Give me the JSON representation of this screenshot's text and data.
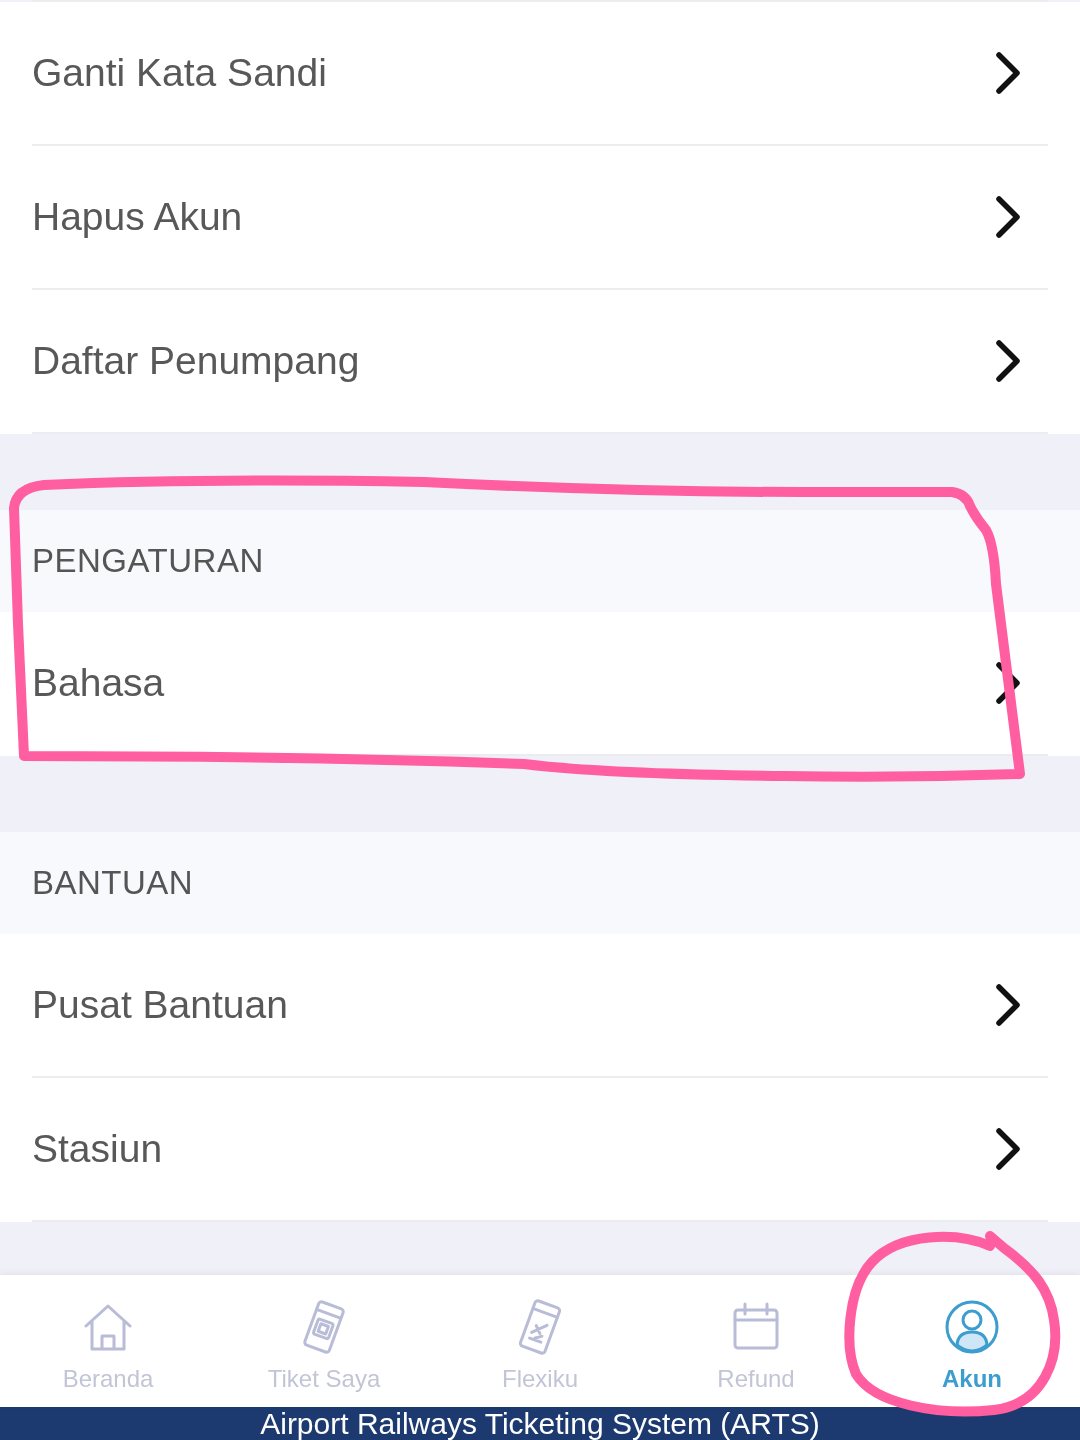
{
  "sections": [
    {
      "highlighted": false,
      "items": [
        "Ganti Kata Sandi",
        "Hapus Akun",
        "Daftar Penumpang"
      ]
    },
    {
      "header": "PENGATURAN",
      "highlighted": true,
      "items": [
        "Bahasa"
      ]
    },
    {
      "header": "BANTUAN",
      "highlighted": false,
      "items": [
        "Pusat Bantuan",
        "Stasiun"
      ]
    }
  ],
  "tab_bar": {
    "tabs": [
      {
        "label": "Beranda",
        "selected": false,
        "highlighted": false
      },
      {
        "label": "Tiket Saya",
        "selected": false,
        "highlighted": false
      },
      {
        "label": "Flexiku",
        "selected": false,
        "highlighted": false
      },
      {
        "label": "Refund",
        "selected": false,
        "highlighted": false
      },
      {
        "label": "Akun",
        "selected": true,
        "highlighted": true
      }
    ]
  },
  "footer": {
    "text": "Airport Railways Ticketing System (ARTS)"
  }
}
